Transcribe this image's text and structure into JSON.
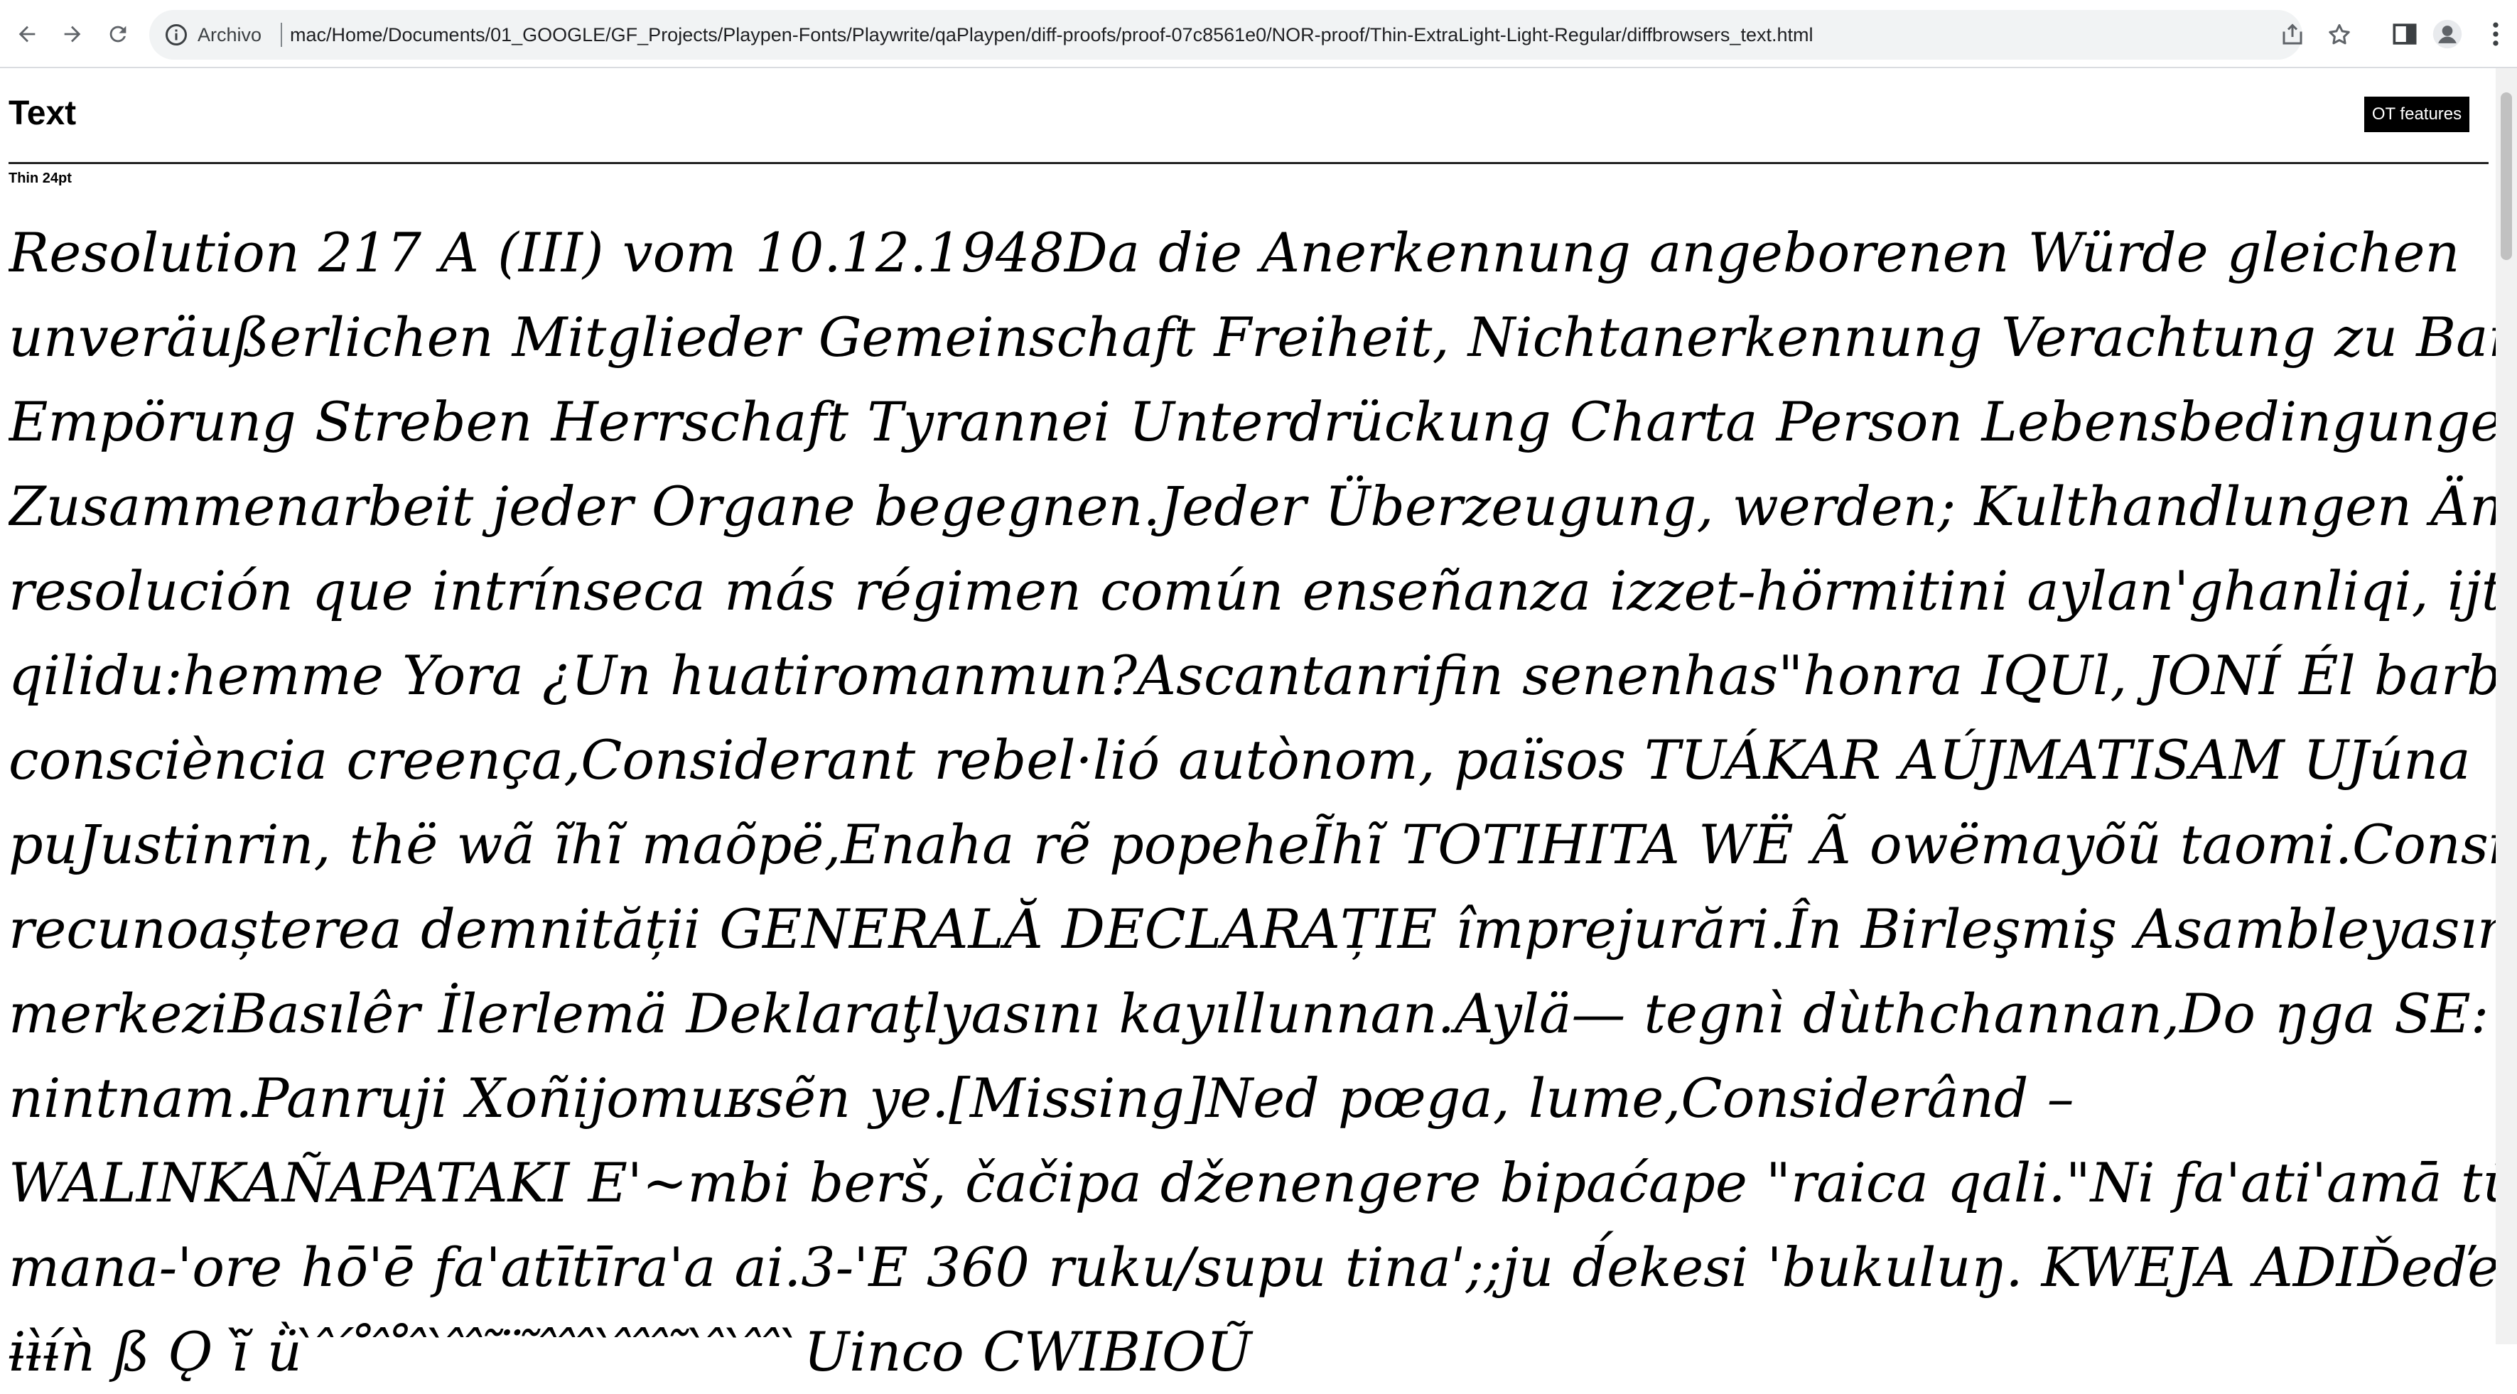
{
  "browser": {
    "chip_label": "Archivo",
    "url": "mac/Home/Documents/01_GOOGLE/GF_Projects/Playpen-Fonts/Playwrite/qaPlaypen/diff-proofs/proof-07c8561e0/NOR-proof/Thin-ExtraLight-Light-Regular/diffbrowsers_text.html"
  },
  "page": {
    "title": "Text",
    "ot_button_label": "OT features",
    "style_label": "Thin 24pt"
  },
  "sample": {
    "lines": [
      "Resolution 217 A (III) vom 10.12.1948Da die Anerkennung angeborenen Würde gleichen",
      "unveräußerlichen Mitglieder Gemeinschaft Freiheit, Nichtanerkennung Verachtung zu Barbarei Gewissen",
      "Empörung Streben Herrschaft Tyrannei Unterdrückung Charta Person Lebensbedingungen",
      "Zusammenarbeit jeder Organe begegnen.Jeder Überzeugung, werden; Kulthandlungen Ämtern Existenz",
      "resolución que intrínseca más régimen común enseñanza izzet-hörmitini aylan'ghanliqi, ijtima'iy",
      "qilidu:hemme Yora ¿Un huatiromanmun?Ascantanrifin senenhas\"honra IQUl, JONÍ Él barbàrie",
      "consciència creença,Considerant rebel·lió autònom, països TUÁKAR AÚJMATISAM UJúna",
      "puJustinrin, thë wã ĩhĩ maõpë,Enaha rẽ popeheĨhĩ TOTIHITA WË Ã owëmayõũ taomi.Considerînd că",
      "recunoașterea demnității GENERALĂ DECLARAȚIE împrejurări.În Birleşmiş Asambleyasının",
      "merkeziBasılêr İlerlemä Deklaraţlyasını kayıllunnan.Aylä— tegnì dùthchannan,Do ŋga SE: KEDENGA",
      "nintnam.Panruji Xoñijomuʁsẽn ye.[Missing]Ned pœga, lume,Considerând –",
      "WALINKAÑAPATAKI E'~mbi berš, čačipa dženengere bipaćape \"raica qali.\"Ni fa'ati'amā tūtu'u-",
      "mana-'ore hō'ē fa'atītīra'a ai.3-'E 360 ruku/supu tinaꞌ;;ju d́ekesi 'bukuluŋ. KWEJA ADIĎeďekarikin",
      "ɨɨ̀ɨ́ǹ ß Ǫ ĩ̀ ǜ ̀ ̂ ́ ̊ ̂ ̊ ̂ ̀ ̂ ̂ ̃ ̈ ̃ ̂ ̂ ̂ ̀ ̂ ̂ ̂ ̃ ̀ ̂ ̀ ̂ ̂ ̀Uinco CWIBIOŨ"
    ]
  }
}
